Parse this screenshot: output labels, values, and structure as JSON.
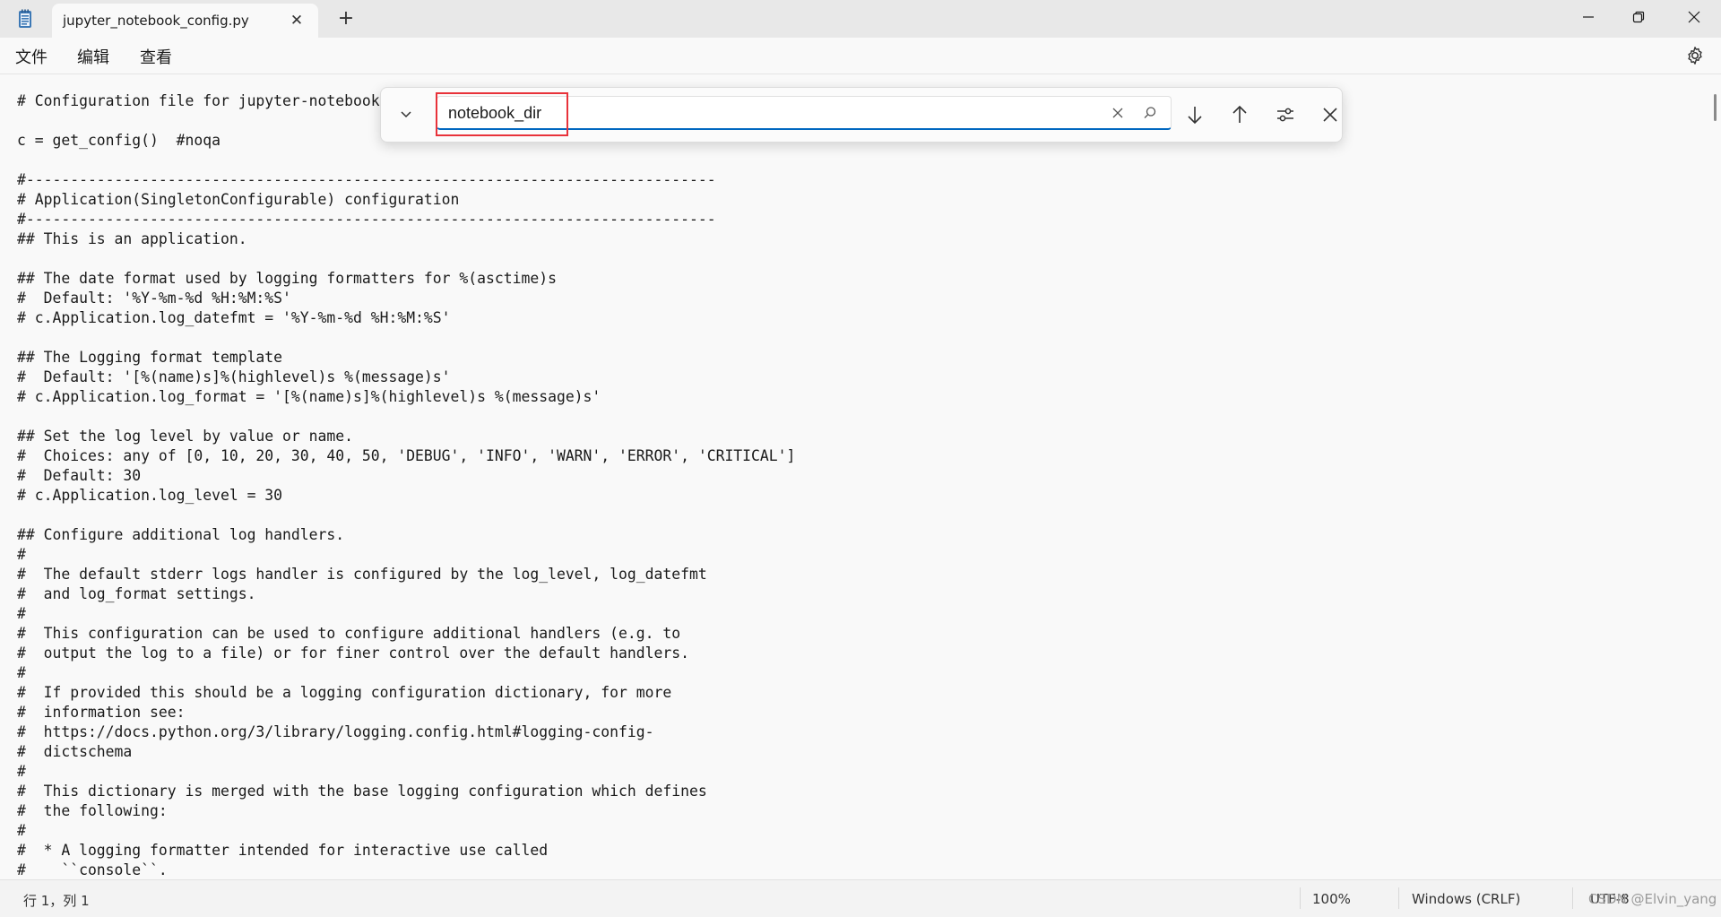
{
  "tab": {
    "title": "jupyter_notebook_config.py"
  },
  "menu": {
    "items": [
      "文件",
      "编辑",
      "查看"
    ]
  },
  "find": {
    "value": "notebook_dir"
  },
  "editor": {
    "lines": [
      "# Configuration file for jupyter-notebook.",
      "",
      "c = get_config()  #noqa",
      "",
      "#------------------------------------------------------------------------------",
      "# Application(SingletonConfigurable) configuration",
      "#------------------------------------------------------------------------------",
      "## This is an application.",
      "",
      "## The date format used by logging formatters for %(asctime)s",
      "#  Default: '%Y-%m-%d %H:%M:%S'",
      "# c.Application.log_datefmt = '%Y-%m-%d %H:%M:%S'",
      "",
      "## The Logging format template",
      "#  Default: '[%(name)s]%(highlevel)s %(message)s'",
      "# c.Application.log_format = '[%(name)s]%(highlevel)s %(message)s'",
      "",
      "## Set the log level by value or name.",
      "#  Choices: any of [0, 10, 20, 30, 40, 50, 'DEBUG', 'INFO', 'WARN', 'ERROR', 'CRITICAL']",
      "#  Default: 30",
      "# c.Application.log_level = 30",
      "",
      "## Configure additional log handlers.",
      "#",
      "#  The default stderr logs handler is configured by the log_level, log_datefmt",
      "#  and log_format settings.",
      "#",
      "#  This configuration can be used to configure additional handlers (e.g. to",
      "#  output the log to a file) or for finer control over the default handlers.",
      "#",
      "#  If provided this should be a logging configuration dictionary, for more",
      "#  information see:",
      "#  https://docs.python.org/3/library/logging.config.html#logging-config-",
      "#  dictschema",
      "#",
      "#  This dictionary is merged with the base logging configuration which defines",
      "#  the following:",
      "#",
      "#  * A logging formatter intended for interactive use called",
      "#    ``console``."
    ]
  },
  "status": {
    "position": "行 1，列 1",
    "zoom": "100%",
    "line_ending": "Windows (CRLF)",
    "encoding": "UTF-8",
    "watermark": "CSDN @Elvin_yang"
  }
}
